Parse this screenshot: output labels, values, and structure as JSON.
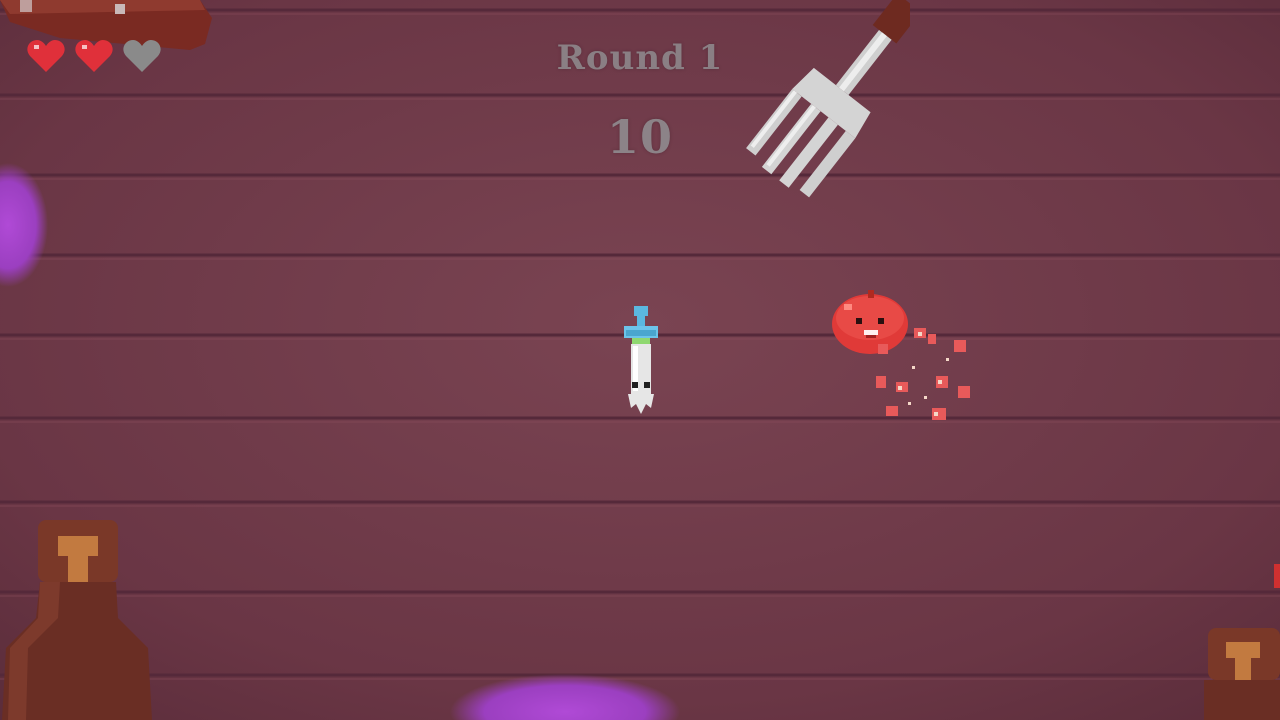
{
  "hud": {
    "round_label": "Round 1",
    "score": "10",
    "hearts": [
      {
        "state": "full"
      },
      {
        "state": "full"
      },
      {
        "state": "empty"
      }
    ]
  },
  "colors": {
    "table": "#6e3a48",
    "plank_line": "#55293a",
    "heart_full": "#e0303a",
    "heart_empty": "#8a8a8a",
    "hud_text": "#8a7f84",
    "tomato": "#e03a38",
    "syringe_cap": "#5bb8e0",
    "jam": "#9b3fc0",
    "bottle": "#6a2e24",
    "fork": "#d8d8d8"
  },
  "icons": {
    "player": "syringe-player-icon",
    "enemy": "tomato-enemy-icon",
    "hazard": "fork-icon",
    "heart": "heart-icon"
  }
}
